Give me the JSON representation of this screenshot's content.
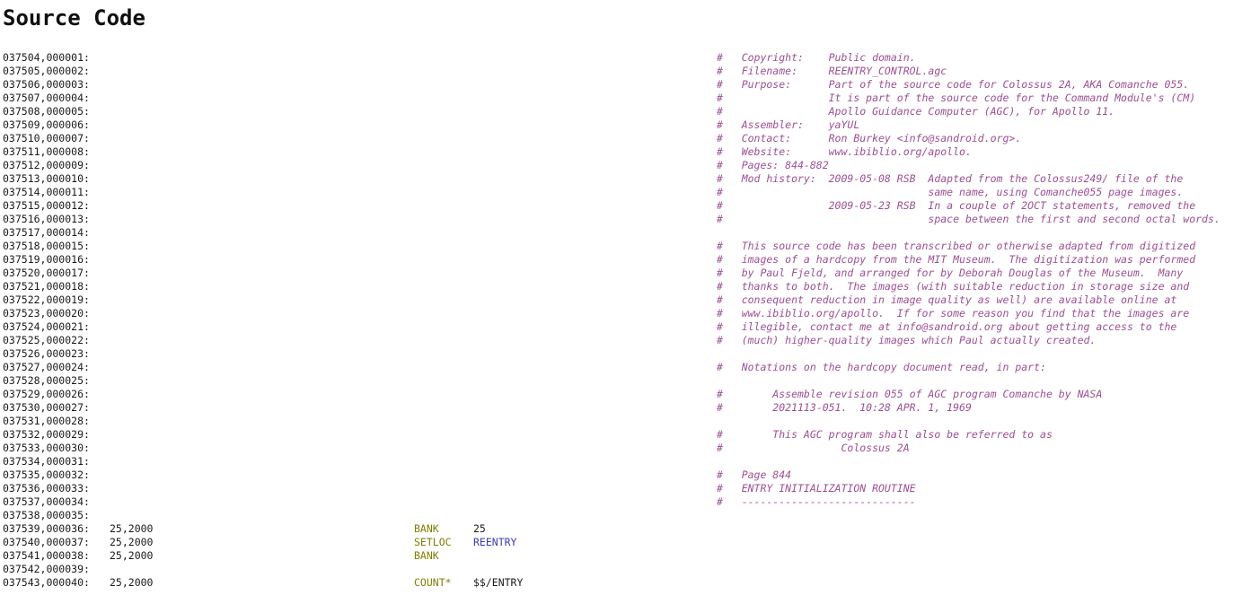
{
  "page": {
    "title": "Source Code",
    "background_color": "#ffffff",
    "text_color": "#1a1a1a",
    "comment_color": "#9c4f93",
    "opcode_color": "#7f7f00",
    "symbol_color": "#3c3cb4"
  },
  "listing": {
    "first_file_line": 37504,
    "first_src_line": 1,
    "line_number_format": "0NNNNN,0NNNNN:",
    "lines": [
      {
        "file_no": "037504",
        "src_no": "000001",
        "addr": "",
        "label": "",
        "op": "",
        "operand": "",
        "comment": "#   Copyright:    Public domain."
      },
      {
        "file_no": "037505",
        "src_no": "000002",
        "addr": "",
        "label": "",
        "op": "",
        "operand": "",
        "comment": "#   Filename:     REENTRY_CONTROL.agc"
      },
      {
        "file_no": "037506",
        "src_no": "000003",
        "addr": "",
        "label": "",
        "op": "",
        "operand": "",
        "comment": "#   Purpose:      Part of the source code for Colossus 2A, AKA Comanche 055."
      },
      {
        "file_no": "037507",
        "src_no": "000004",
        "addr": "",
        "label": "",
        "op": "",
        "operand": "",
        "comment": "#                 It is part of the source code for the Command Module's (CM)"
      },
      {
        "file_no": "037508",
        "src_no": "000005",
        "addr": "",
        "label": "",
        "op": "",
        "operand": "",
        "comment": "#                 Apollo Guidance Computer (AGC), for Apollo 11."
      },
      {
        "file_no": "037509",
        "src_no": "000006",
        "addr": "",
        "label": "",
        "op": "",
        "operand": "",
        "comment": "#   Assembler:    yaYUL"
      },
      {
        "file_no": "037510",
        "src_no": "000007",
        "addr": "",
        "label": "",
        "op": "",
        "operand": "",
        "comment": "#   Contact:      Ron Burkey <info@sandroid.org>."
      },
      {
        "file_no": "037511",
        "src_no": "000008",
        "addr": "",
        "label": "",
        "op": "",
        "operand": "",
        "comment": "#   Website:      www.ibiblio.org/apollo."
      },
      {
        "file_no": "037512",
        "src_no": "000009",
        "addr": "",
        "label": "",
        "op": "",
        "operand": "",
        "comment": "#   Pages: 844-882"
      },
      {
        "file_no": "037513",
        "src_no": "000010",
        "addr": "",
        "label": "",
        "op": "",
        "operand": "",
        "comment": "#   Mod history:  2009-05-08 RSB  Adapted from the Colossus249/ file of the"
      },
      {
        "file_no": "037514",
        "src_no": "000011",
        "addr": "",
        "label": "",
        "op": "",
        "operand": "",
        "comment": "#                                 same name, using Comanche055 page images."
      },
      {
        "file_no": "037515",
        "src_no": "000012",
        "addr": "",
        "label": "",
        "op": "",
        "operand": "",
        "comment": "#                 2009-05-23 RSB  In a couple of 2OCT statements, removed the"
      },
      {
        "file_no": "037516",
        "src_no": "000013",
        "addr": "",
        "label": "",
        "op": "",
        "operand": "",
        "comment": "#                                 space between the first and second octal words."
      },
      {
        "file_no": "037517",
        "src_no": "000014",
        "addr": "",
        "label": "",
        "op": "",
        "operand": "",
        "comment": ""
      },
      {
        "file_no": "037518",
        "src_no": "000015",
        "addr": "",
        "label": "",
        "op": "",
        "operand": "",
        "comment": "#   This source code has been transcribed or otherwise adapted from digitized"
      },
      {
        "file_no": "037519",
        "src_no": "000016",
        "addr": "",
        "label": "",
        "op": "",
        "operand": "",
        "comment": "#   images of a hardcopy from the MIT Museum.  The digitization was performed"
      },
      {
        "file_no": "037520",
        "src_no": "000017",
        "addr": "",
        "label": "",
        "op": "",
        "operand": "",
        "comment": "#   by Paul Fjeld, and arranged for by Deborah Douglas of the Museum.  Many"
      },
      {
        "file_no": "037521",
        "src_no": "000018",
        "addr": "",
        "label": "",
        "op": "",
        "operand": "",
        "comment": "#   thanks to both.  The images (with suitable reduction in storage size and"
      },
      {
        "file_no": "037522",
        "src_no": "000019",
        "addr": "",
        "label": "",
        "op": "",
        "operand": "",
        "comment": "#   consequent reduction in image quality as well) are available online at"
      },
      {
        "file_no": "037523",
        "src_no": "000020",
        "addr": "",
        "label": "",
        "op": "",
        "operand": "",
        "comment": "#   www.ibiblio.org/apollo.  If for some reason you find that the images are"
      },
      {
        "file_no": "037524",
        "src_no": "000021",
        "addr": "",
        "label": "",
        "op": "",
        "operand": "",
        "comment": "#   illegible, contact me at info@sandroid.org about getting access to the"
      },
      {
        "file_no": "037525",
        "src_no": "000022",
        "addr": "",
        "label": "",
        "op": "",
        "operand": "",
        "comment": "#   (much) higher-quality images which Paul actually created."
      },
      {
        "file_no": "037526",
        "src_no": "000023",
        "addr": "",
        "label": "",
        "op": "",
        "operand": "",
        "comment": ""
      },
      {
        "file_no": "037527",
        "src_no": "000024",
        "addr": "",
        "label": "",
        "op": "",
        "operand": "",
        "comment": "#   Notations on the hardcopy document read, in part:"
      },
      {
        "file_no": "037528",
        "src_no": "000025",
        "addr": "",
        "label": "",
        "op": "",
        "operand": "",
        "comment": ""
      },
      {
        "file_no": "037529",
        "src_no": "000026",
        "addr": "",
        "label": "",
        "op": "",
        "operand": "",
        "comment": "#        Assemble revision 055 of AGC program Comanche by NASA"
      },
      {
        "file_no": "037530",
        "src_no": "000027",
        "addr": "",
        "label": "",
        "op": "",
        "operand": "",
        "comment": "#        2021113-051.  10:28 APR. 1, 1969"
      },
      {
        "file_no": "037531",
        "src_no": "000028",
        "addr": "",
        "label": "",
        "op": "",
        "operand": "",
        "comment": ""
      },
      {
        "file_no": "037532",
        "src_no": "000029",
        "addr": "",
        "label": "",
        "op": "",
        "operand": "",
        "comment": "#        This AGC program shall also be referred to as"
      },
      {
        "file_no": "037533",
        "src_no": "000030",
        "addr": "",
        "label": "",
        "op": "",
        "operand": "",
        "comment": "#                   Colossus 2A"
      },
      {
        "file_no": "037534",
        "src_no": "000031",
        "addr": "",
        "label": "",
        "op": "",
        "operand": "",
        "comment": ""
      },
      {
        "file_no": "037535",
        "src_no": "000032",
        "addr": "",
        "label": "",
        "op": "",
        "operand": "",
        "comment": "#   Page 844"
      },
      {
        "file_no": "037536",
        "src_no": "000033",
        "addr": "",
        "label": "",
        "op": "",
        "operand": "",
        "comment": "#   ENTRY INITIALIZATION ROUTINE"
      },
      {
        "file_no": "037537",
        "src_no": "000034",
        "addr": "",
        "label": "",
        "op": "",
        "operand": "",
        "comment": "#   ----------------------------"
      },
      {
        "file_no": "037538",
        "src_no": "000035",
        "addr": "",
        "label": "",
        "op": "",
        "operand": "",
        "comment": ""
      },
      {
        "file_no": "037539",
        "src_no": "000036",
        "addr": "25,2000",
        "label": "",
        "op": "BANK",
        "operand": "25",
        "operand_kind": "number",
        "comment": ""
      },
      {
        "file_no": "037540",
        "src_no": "000037",
        "addr": "25,2000",
        "label": "",
        "op": "SETLOC",
        "operand": "REENTRY",
        "operand_kind": "symbol",
        "comment": ""
      },
      {
        "file_no": "037541",
        "src_no": "000038",
        "addr": "25,2000",
        "label": "",
        "op": "BANK",
        "operand": "",
        "comment": ""
      },
      {
        "file_no": "037542",
        "src_no": "000039",
        "addr": "",
        "label": "",
        "op": "",
        "operand": "",
        "comment": ""
      },
      {
        "file_no": "037543",
        "src_no": "000040",
        "addr": "25,2000",
        "label": "",
        "op": "COUNT*",
        "operand": "$$/ENTRY",
        "operand_kind": "number",
        "comment": ""
      }
    ]
  }
}
